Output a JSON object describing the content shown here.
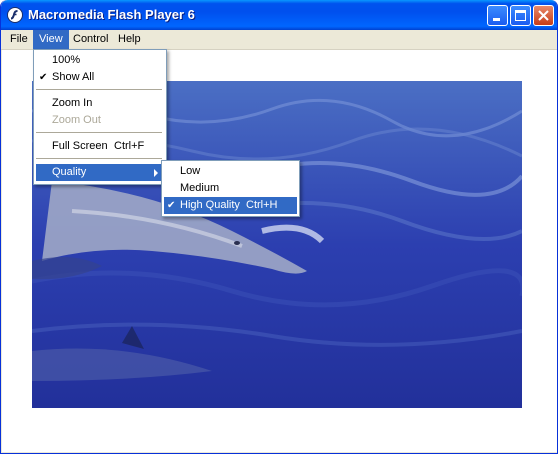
{
  "window": {
    "title": "Macromedia Flash Player 6"
  },
  "menubar": {
    "items": [
      "File",
      "View",
      "Control",
      "Help"
    ]
  },
  "view_menu": {
    "items": [
      {
        "label": "100%",
        "checked": false,
        "disabled": false
      },
      {
        "label": "Show All",
        "checked": true,
        "disabled": false
      },
      {
        "label": "Zoom In",
        "checked": false,
        "disabled": false
      },
      {
        "label": "Zoom Out",
        "checked": false,
        "disabled": true
      },
      {
        "label": "Full Screen",
        "shortcut": "Ctrl+F",
        "checked": false,
        "disabled": false
      },
      {
        "label": "Quality",
        "checked": false,
        "disabled": false,
        "submenu": true
      }
    ]
  },
  "quality_submenu": {
    "items": [
      {
        "label": "Low",
        "checked": false
      },
      {
        "label": "Medium",
        "checked": false
      },
      {
        "label": "High Quality",
        "shortcut": "Ctrl+H",
        "checked": true
      }
    ]
  },
  "colors": {
    "titlebar": "#0054e3",
    "menu_highlight": "#316ac5",
    "water": "#2a3ba6"
  }
}
